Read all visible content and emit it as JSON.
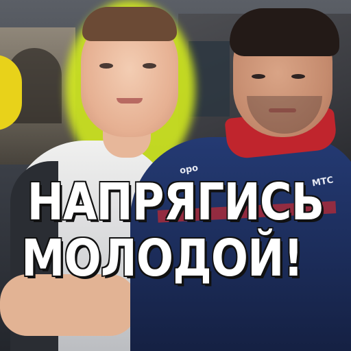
{
  "headline": {
    "line1": "НАПРЯГИСЬ",
    "line2": "МОЛОДОЙ!"
  },
  "jersey": {
    "badge_left": "оро",
    "badge_right": "МТС"
  },
  "colors": {
    "glow": "#d9f21c",
    "accent_yellow": "#e8d21a",
    "jersey_blue": "#1c2d5b",
    "collar_red": "#c0252d",
    "text": "#ffffff",
    "text_outline": "#111111"
  }
}
